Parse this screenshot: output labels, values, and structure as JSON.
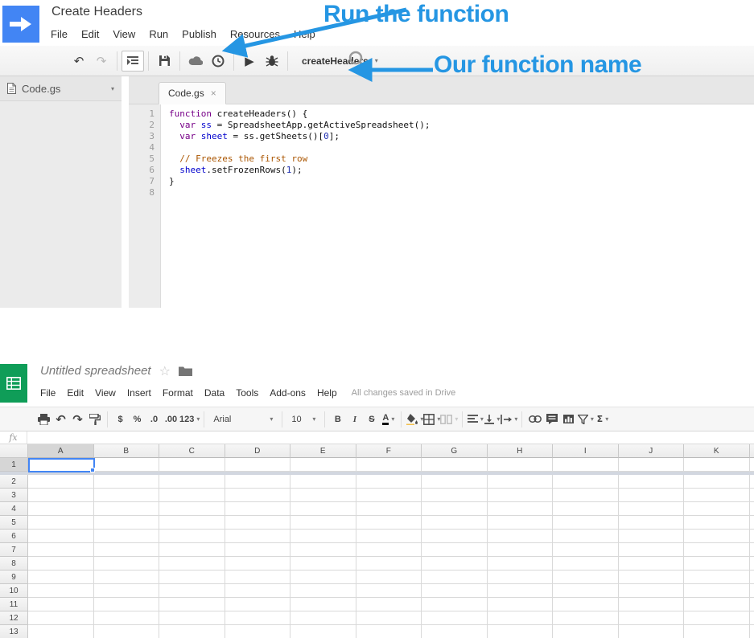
{
  "colors": {
    "annotation_blue": "#2596e3",
    "script_logo_blue": "#4285f4",
    "sheets_green": "#0f9d58",
    "selection_blue": "#4285f4"
  },
  "glyphs": {
    "caret": "▾",
    "undo": "↶",
    "redo": "↷",
    "play": "▶",
    "cloud": "☁",
    "star": "☆",
    "close": "×"
  },
  "apps_script": {
    "window_title": "Create Headers",
    "menu_items": [
      "File",
      "Edit",
      "View",
      "Run",
      "Publish",
      "Resources",
      "Help"
    ],
    "toolbar": {
      "function_selector": "createHeaders"
    },
    "files_sidebar": {
      "file_name": "Code.gs"
    },
    "editor_tab": "Code.gs",
    "code": {
      "lines": [
        {
          "num": "1",
          "segments": [
            [
              "function",
              "kw"
            ],
            [
              " createHeaders() {",
              "pl"
            ]
          ]
        },
        {
          "num": "2",
          "segments": [
            [
              "  ",
              "pl"
            ],
            [
              "var",
              "kw"
            ],
            [
              " ",
              "pl"
            ],
            [
              "ss",
              "vr"
            ],
            [
              " = SpreadsheetApp.getActiveSpreadsheet();",
              "pl"
            ]
          ]
        },
        {
          "num": "3",
          "segments": [
            [
              "  ",
              "pl"
            ],
            [
              "var",
              "kw"
            ],
            [
              " ",
              "pl"
            ],
            [
              "sheet",
              "vr"
            ],
            [
              " = ss.getSheets()[",
              "pl"
            ],
            [
              "0",
              "nm"
            ],
            [
              "];",
              "pl"
            ]
          ]
        },
        {
          "num": "4",
          "segments": []
        },
        {
          "num": "5",
          "segments": [
            [
              "  ",
              "pl"
            ],
            [
              "// Freezes the first row",
              "cm"
            ]
          ]
        },
        {
          "num": "6",
          "segments": [
            [
              "  ",
              "pl"
            ],
            [
              "sheet",
              "vr"
            ],
            [
              ".setFrozenRows(",
              "pl"
            ],
            [
              "1",
              "nm"
            ],
            [
              ");",
              "pl"
            ]
          ]
        },
        {
          "num": "7",
          "segments": [
            [
              "}",
              "pl"
            ]
          ]
        },
        {
          "num": "8",
          "segments": []
        }
      ]
    }
  },
  "annotations": {
    "run_label": "Run the function",
    "function_name_label": "Our function name"
  },
  "sheets": {
    "doc_title": "Untitled spreadsheet",
    "menu_items": [
      "File",
      "Edit",
      "View",
      "Insert",
      "Format",
      "Data",
      "Tools",
      "Add-ons",
      "Help"
    ],
    "status_text": "All changes saved in Drive",
    "toolbar": {
      "currency": "$",
      "percent": "%",
      "decrease_decimal": ".0",
      "increase_decimal": ".00",
      "more_formats": "123",
      "font_family": "Arial",
      "font_size": "10",
      "bold": "B",
      "italic": "I",
      "strikethrough": "S",
      "text_color": "A",
      "sum": "Σ"
    },
    "formula_bar": {
      "fx_label": "fx",
      "value": ""
    },
    "grid": {
      "columns": [
        "A",
        "B",
        "C",
        "D",
        "E",
        "F",
        "G",
        "H",
        "I",
        "J",
        "K"
      ],
      "row_count": 13,
      "selected_cell": "A1",
      "selected_column": "A",
      "selected_row": "1",
      "frozen_rows": 1
    }
  }
}
